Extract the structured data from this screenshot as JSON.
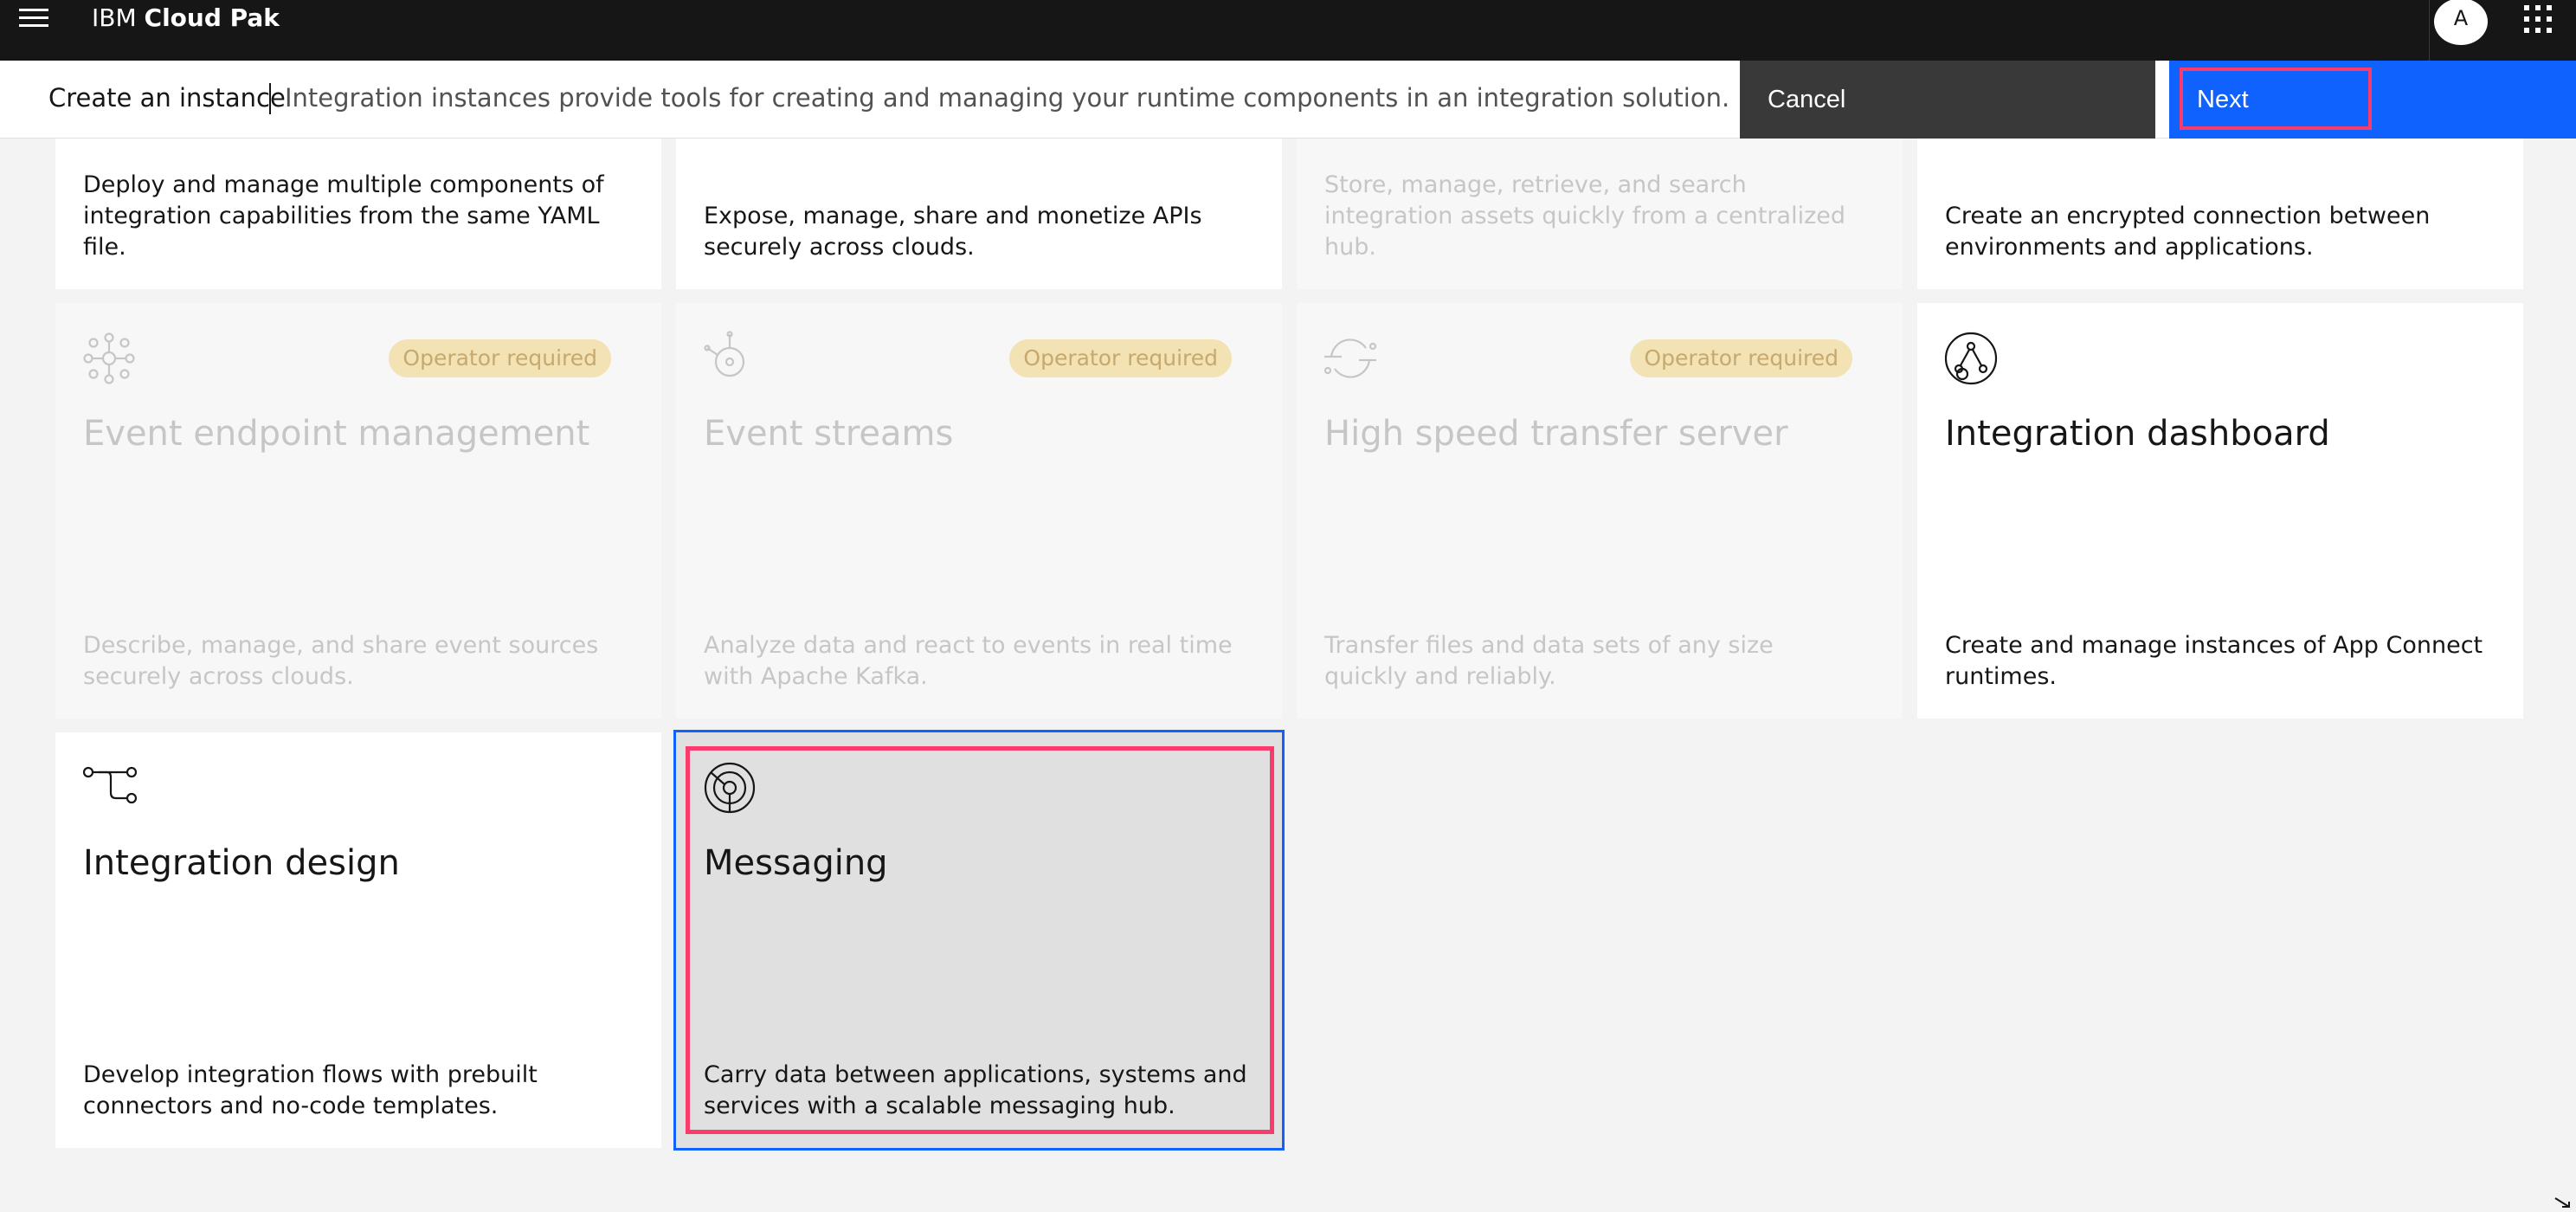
{
  "topbar": {
    "brand_prefix": "IBM ",
    "brand_name": "Cloud Pak",
    "avatar_initial": "A"
  },
  "subheader": {
    "title": "Create an instance",
    "description": "Integration instances provide tools for creating and managing your runtime components in an integration solution.",
    "cancel_label": "Cancel",
    "next_label": "Next"
  },
  "tiles_top": [
    {
      "desc": "Deploy and manage multiple components of integration capabilities from the same YAML file.",
      "disabled": false
    },
    {
      "desc": "Expose, manage, share and monetize APIs securely across clouds.",
      "disabled": false
    },
    {
      "desc": "Store, manage, retrieve, and search integration assets quickly from a centralized hub.",
      "disabled": true
    },
    {
      "desc": "Create an encrypted connection between environments and applications.",
      "disabled": false
    }
  ],
  "tiles_mid": [
    {
      "title": "Event endpoint management",
      "badge": "Operator required",
      "icon": "network-nodes-icon",
      "desc": "Describe, manage, and share event sources securely across clouds.",
      "disabled": true
    },
    {
      "title": "Event streams",
      "badge": "Operator required",
      "icon": "event-stream-icon",
      "desc": "Analyze data and react to events in real time with Apache Kafka.",
      "disabled": true
    },
    {
      "title": "High speed transfer server",
      "badge": "Operator required",
      "icon": "transfer-icon",
      "desc": "Transfer files and data sets of any size quickly and reliably.",
      "disabled": true
    },
    {
      "title": "Integration dashboard",
      "icon": "dashboard-icon",
      "desc": "Create and manage instances of App Connect runtimes.",
      "disabled": false
    }
  ],
  "tiles_bottom": [
    {
      "title": "Integration design",
      "icon": "flow-design-icon",
      "desc": "Develop integration flows with prebuilt connectors and no-code templates.",
      "disabled": false
    },
    {
      "title": "Messaging",
      "icon": "messaging-icon",
      "desc": "Carry data between applications, systems and services with a scalable messaging hub.",
      "selected": true
    }
  ],
  "colors": {
    "accent": "#0f62fe",
    "highlight": "#fa3b6e",
    "topbar": "#161616",
    "badge_bg": "#f2e2b4"
  }
}
